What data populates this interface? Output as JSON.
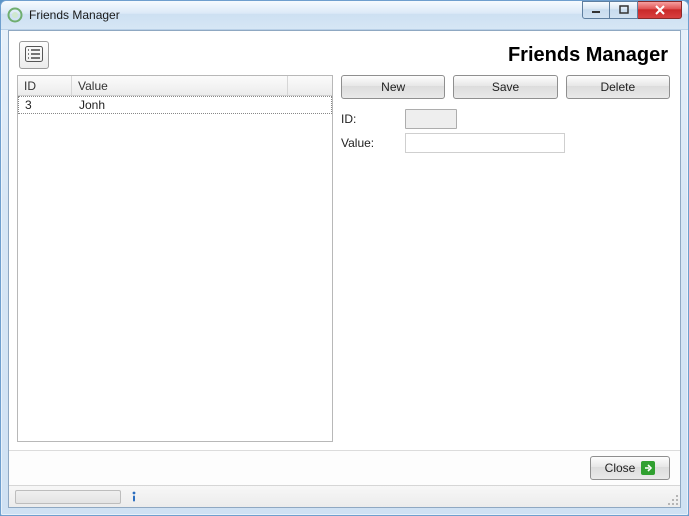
{
  "window": {
    "title": "Friends Manager"
  },
  "header": {
    "page_title": "Friends Manager"
  },
  "table": {
    "columns": {
      "id": "ID",
      "value": "Value"
    },
    "rows": [
      {
        "id": "3",
        "value": "Jonh"
      }
    ]
  },
  "buttons": {
    "new": "New",
    "save": "Save",
    "delete": "Delete",
    "close": "Close"
  },
  "form": {
    "id_label": "ID:",
    "id_value": "",
    "value_label": "Value:",
    "value_value": ""
  }
}
